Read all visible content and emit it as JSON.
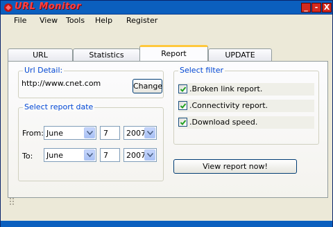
{
  "window": {
    "title": "URL Monitor",
    "buttons": {
      "minimize": "_",
      "maximize": "-",
      "close": "X"
    }
  },
  "menu": [
    "File",
    "View",
    "Tools",
    "Help",
    "Register"
  ],
  "tabs": [
    {
      "label": "URL",
      "active": false
    },
    {
      "label": "Statistics",
      "active": false
    },
    {
      "label": "Report",
      "active": true
    },
    {
      "label": "UPDATE",
      "active": false
    }
  ],
  "url_detail": {
    "legend": "Url Detail:",
    "url": "http://www.cnet.com",
    "change_label": "Change"
  },
  "report_date": {
    "legend": "Select report date",
    "from_label": "From:",
    "to_label": "To:",
    "from": {
      "month": "June",
      "day": "7",
      "year": "2007"
    },
    "to": {
      "month": "June",
      "day": "7",
      "year": "2007"
    }
  },
  "filter": {
    "legend": "Select filter",
    "options": [
      {
        "label": ".Broken link report.",
        "checked": true
      },
      {
        "label": ".Connectivity report.",
        "checked": true
      },
      {
        "label": ".Download speed.",
        "checked": true
      }
    ]
  },
  "view_report_label": "View report now!",
  "colors": {
    "titlebar": "#0b5fbe",
    "title_text": "#ff4040",
    "legend_text": "#0046d5",
    "active_tab_accent": "#ffc83c",
    "close_button": "#d42a1e"
  }
}
